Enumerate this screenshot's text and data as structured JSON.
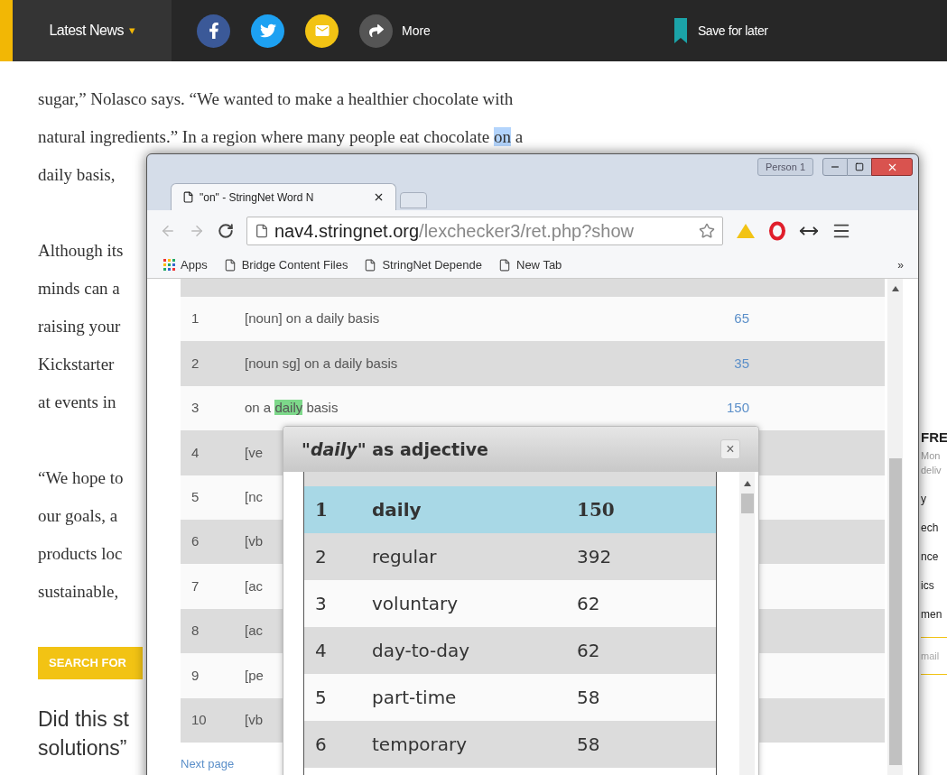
{
  "top_bar": {
    "section_menu": "Latest News",
    "menu_caret": "▾",
    "share": [
      {
        "kind": "facebook"
      },
      {
        "kind": "twitter"
      },
      {
        "kind": "email"
      },
      {
        "kind": "more",
        "label": "More"
      }
    ],
    "save": "Save for later"
  },
  "article": {
    "paragraphs": [
      [
        [
          {
            "text": "sugar,” Nolasco says. “We wanted to make a healthier chocolate with",
            "highlighted": false
          }
        ],
        [
          {
            "text": "natural ingredients.” In a region where many people eat chocolate ",
            "highlighted": false
          },
          {
            "text": "on",
            "highlighted": true
          },
          {
            "text": " a",
            "highlighted": false
          }
        ],
        [
          {
            "text": "daily basis,",
            "highlighted": false
          }
        ]
      ],
      [
        [
          {
            "text": "Although its",
            "highlighted": false
          }
        ],
        [
          {
            "text": "minds can a",
            "highlighted": false
          }
        ],
        [
          {
            "text": "raising your",
            "highlighted": false
          }
        ],
        [
          {
            "text": "Kickstarter",
            "highlighted": false
          }
        ],
        [
          {
            "text": "at events in",
            "highlighted": false
          }
        ]
      ],
      [
        [
          {
            "text": "“We hope to",
            "highlighted": false
          }
        ],
        [
          {
            "text": "our goals, a",
            "highlighted": false
          }
        ],
        [
          {
            "text": "products loc",
            "highlighted": false
          }
        ],
        [
          {
            "text": "sustainable,",
            "highlighted": false
          }
        ]
      ]
    ],
    "search_button": "SEARCH FOR",
    "prompt_lines": [
      "Did this st",
      "solutions”"
    ]
  },
  "sidebar_fragments": [
    {
      "kind": "heading",
      "text": "FRE"
    },
    {
      "kind": "note",
      "text": "Mon"
    },
    {
      "kind": "note",
      "text": "deliv"
    },
    {
      "kind": "link",
      "text": "y"
    },
    {
      "kind": "link",
      "text": "ech"
    },
    {
      "kind": "link",
      "text": "nce"
    },
    {
      "kind": "link",
      "text": "ics"
    },
    {
      "kind": "link",
      "text": "men"
    },
    {
      "kind": "input",
      "text": "mail"
    }
  ],
  "browser": {
    "profile": "Person 1",
    "tab_title": "\"on\" - StringNet Word N",
    "url_host": "nav4.stringnet.org",
    "url_path": "/lexchecker3/ret.php?show",
    "bookmarks": [
      "Apps",
      "Bridge Content Files",
      "StringNet Depende",
      "New Tab"
    ],
    "bookmarks_overflow": "»",
    "rows": [
      {
        "number": "1",
        "segments": [
          {
            "text": "[noun] on a daily basis",
            "highlighted": false
          }
        ],
        "count": "65"
      },
      {
        "number": "2",
        "segments": [
          {
            "text": "[noun sg] on a daily basis",
            "highlighted": false
          }
        ],
        "count": "35"
      },
      {
        "number": "3",
        "segments": [
          {
            "text": "on a ",
            "highlighted": false
          },
          {
            "text": "daily",
            "highlighted": true
          },
          {
            "text": " basis",
            "highlighted": false
          }
        ],
        "count": "150"
      },
      {
        "number": "4",
        "segments": [
          {
            "text": "[ve",
            "highlighted": false
          }
        ]
      },
      {
        "number": "5",
        "segments": [
          {
            "text": "[nc",
            "highlighted": false
          }
        ]
      },
      {
        "number": "6",
        "segments": [
          {
            "text": "[vb",
            "highlighted": false
          }
        ]
      },
      {
        "number": "7",
        "segments": [
          {
            "text": "[ac",
            "highlighted": false
          }
        ]
      },
      {
        "number": "8",
        "segments": [
          {
            "text": "[ac",
            "highlighted": false
          }
        ]
      },
      {
        "number": "9",
        "segments": [
          {
            "text": "[pe",
            "highlighted": false
          }
        ]
      },
      {
        "number": "10",
        "segments": [
          {
            "text": "[vb",
            "highlighted": false
          }
        ]
      }
    ],
    "next_page": "Next page"
  },
  "popup": {
    "title": "\"*daily*\" as adjective",
    "close": "×",
    "rows": [
      {
        "number": "1",
        "word": "daily",
        "count": "150",
        "selected": true
      },
      {
        "number": "2",
        "word": "regular",
        "count": "392",
        "selected": false
      },
      {
        "number": "3",
        "word": "voluntary",
        "count": "62",
        "selected": false
      },
      {
        "number": "4",
        "word": "day-to-day",
        "count": "62",
        "selected": false
      },
      {
        "number": "5",
        "word": "part-time",
        "count": "58",
        "selected": false
      },
      {
        "number": "6",
        "word": "temporary",
        "count": "58",
        "selected": false
      }
    ]
  }
}
